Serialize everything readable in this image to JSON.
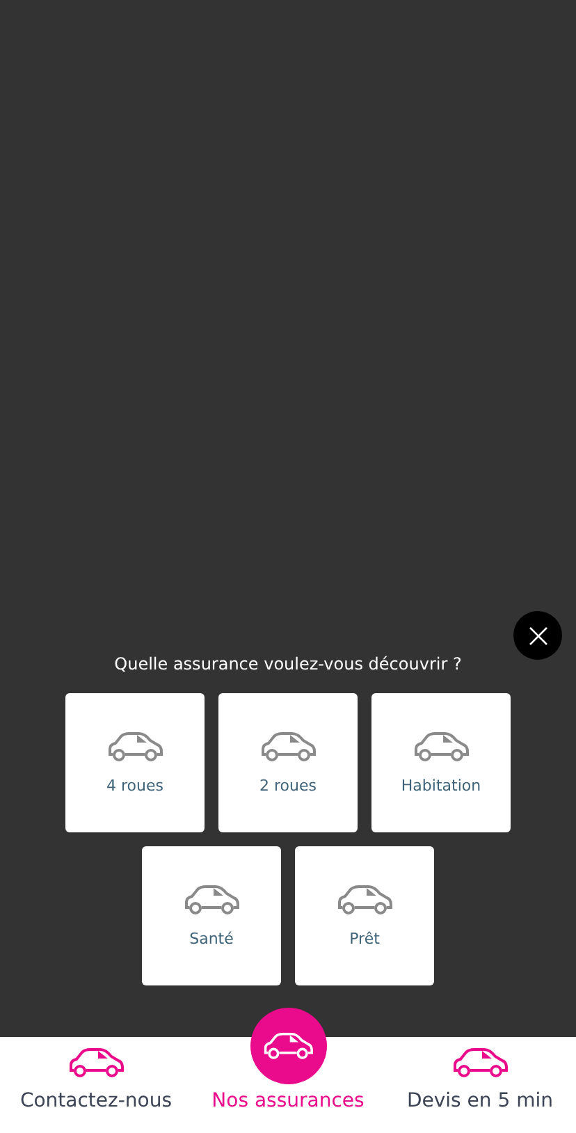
{
  "dialog": {
    "question": "Quelle assurance voulez-vous découvrir ?"
  },
  "options": [
    {
      "label": "4 roues"
    },
    {
      "label": "2 roues"
    },
    {
      "label": "Habitation"
    },
    {
      "label": "Santé"
    },
    {
      "label": "Prêt"
    }
  ],
  "nav": [
    {
      "label": "Contactez-nous",
      "selected": false
    },
    {
      "label": "Nos assurances",
      "selected": true
    },
    {
      "label": "Devis en 5 min",
      "selected": false
    }
  ]
}
